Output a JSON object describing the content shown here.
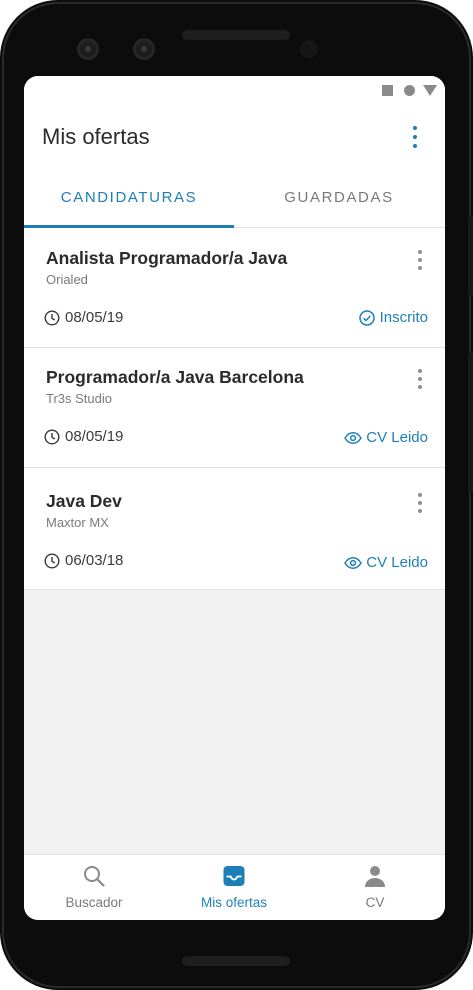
{
  "colors": {
    "accent": "#1e7fb8",
    "text": "#2b2b2b",
    "muted": "#7a7a7a",
    "nav_inactive": "#8a8a8a",
    "background": "#f2f2f2"
  },
  "header": {
    "title": "Mis ofertas",
    "menu_icon": "more-vert-icon"
  },
  "tabs": [
    {
      "label": "CANDIDATURAS",
      "selected": true
    },
    {
      "label": "GUARDADAS",
      "selected": false
    }
  ],
  "applications": [
    {
      "title": "Analista Programador/a Java",
      "company": "Orialed",
      "date": "08/05/19",
      "status": "Inscrito",
      "status_icon": "check-circle-icon"
    },
    {
      "title": "Programador/a Java Barcelona",
      "company": "Tr3s Studio",
      "date": "08/05/19",
      "status": "CV Leido",
      "status_icon": "eye-icon"
    },
    {
      "title": "Java Dev",
      "company": "Maxtor MX",
      "date": "06/03/18",
      "status": "CV Leido",
      "status_icon": "eye-icon"
    }
  ],
  "bottom_nav": [
    {
      "label": "Buscador",
      "icon": "search-icon",
      "active": false
    },
    {
      "label": "Mis ofertas",
      "icon": "briefcase-icon",
      "active": true
    },
    {
      "label": "CV",
      "icon": "person-icon",
      "active": false
    }
  ]
}
